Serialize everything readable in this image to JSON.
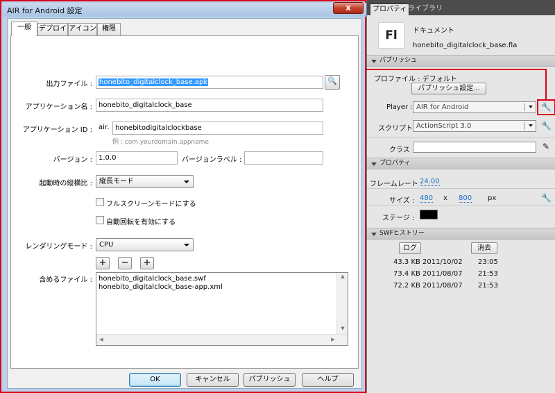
{
  "dialog": {
    "title": "AIR for Android 設定",
    "close_glyph": "x",
    "tabs": [
      {
        "label": "一般"
      },
      {
        "label": "デプロイ"
      },
      {
        "label": "アイコン"
      },
      {
        "label": "権限"
      }
    ],
    "output_file": {
      "label": "出力ファイル :",
      "value": "honebito_digitalclock_base.apk"
    },
    "app_name": {
      "label": "アプリケーション名 :",
      "value": "honebito_digitalclock_base"
    },
    "app_id": {
      "label": "アプリケーション ID :",
      "prefix": "air.",
      "value": "honebitodigitalclockbase",
      "hint": "例 : com.yourdomain.appname"
    },
    "version": {
      "label": "バージョン :",
      "value": "1.0.0"
    },
    "version_label": {
      "label": "バージョンラベル :",
      "value": ""
    },
    "aspect": {
      "label": "起動時の縦横比 :",
      "value": "縦長モード"
    },
    "fullscreen": {
      "label": "フルスクリーンモードにする",
      "checked": false
    },
    "autorotate": {
      "label": "自動回転を有効にする",
      "checked": false
    },
    "render_mode": {
      "label": "レンダリングモード :",
      "value": "CPU"
    },
    "included_files": {
      "label": "含めるファイル :",
      "add_glyph": "+",
      "remove_glyph": "−",
      "folder_glyph": "+",
      "items": [
        "honebito_digitalclock_base.swf",
        "honebito_digitalclock_base-app.xml"
      ]
    },
    "buttons": {
      "ok": "OK",
      "cancel": "キャンセル",
      "publish": "パブリッシュ",
      "help": "ヘルプ"
    }
  },
  "panel": {
    "tabs": [
      "プロパティ",
      "ライブラリ"
    ],
    "doc_icon_text": "Fl",
    "doc_type": "ドキュメント",
    "doc_name": "honebito_digitalclock_base.fla",
    "publish_section": "パブリッシュ",
    "profile_label": "プロファイル : デフォルト",
    "publish_settings_button": "パブリッシュ設定...",
    "player_label": "Player :",
    "player_value": "AIR for Android",
    "script_label": "スクリプト :",
    "script_value": "ActionScript 3.0",
    "class_label": "クラス :",
    "class_value": "",
    "properties_section": "プロパティ",
    "framerate_label": "フレームレート :",
    "framerate_value": "24.00",
    "size_label": "サイズ :",
    "size_w": "480",
    "size_x": "x",
    "size_h": "800",
    "size_unit": "px",
    "stage_label": "ステージ :",
    "stage_color": "#000000",
    "swf_section": "SWFヒストリー",
    "log_button": "ログ",
    "clear_button": "消去",
    "history": [
      {
        "size": "43.3 KB",
        "date": "2011/10/02",
        "time": "23:05"
      },
      {
        "size": "73.4 KB",
        "date": "2011/08/07",
        "time": "21:53"
      },
      {
        "size": "72.2 KB",
        "date": "2011/08/07",
        "time": "21:53"
      }
    ]
  }
}
